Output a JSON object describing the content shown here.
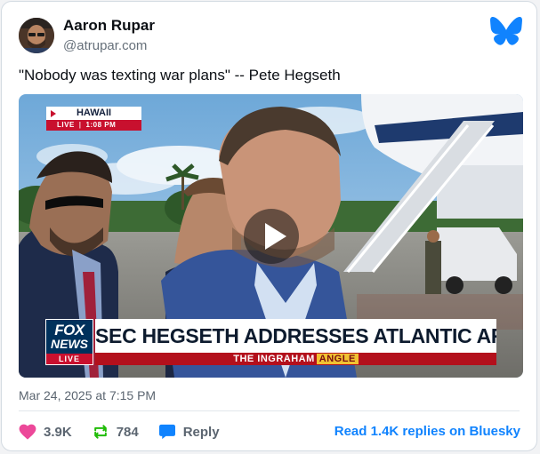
{
  "post": {
    "author_name": "Aaron Rupar",
    "author_handle": "@atrupar.com",
    "text": "\"Nobody was texting war plans\" -- Pete Hegseth",
    "timestamp": "Mar 24, 2025 at 7:15 PM"
  },
  "video": {
    "location_tag": "HAWAII",
    "live_tag": "LIVE",
    "time_tag": "1:08 PM",
    "network_logo": [
      "FOX",
      "NEWS",
      "LIVE"
    ],
    "headline": "SEC HEGSETH ADDRESSES ATLANTIC ARTICLE",
    "show_name_prefix": "THE",
    "show_name_main": "INGRAHAM",
    "show_name_suffix": "ANGLE"
  },
  "actions": {
    "likes": "3.9K",
    "reposts": "784",
    "reply_label": "Reply",
    "read_replies_label": "Read 1.4K replies on Bluesky"
  },
  "colors": {
    "bluesky_blue": "#1083fe",
    "like_pink": "#ec4899",
    "repost_green": "#20bc07",
    "fox_red": "#c8102e"
  },
  "icons": [
    "avatar",
    "butterfly-icon",
    "play-icon",
    "heart-icon",
    "repost-icon",
    "reply-icon"
  ]
}
